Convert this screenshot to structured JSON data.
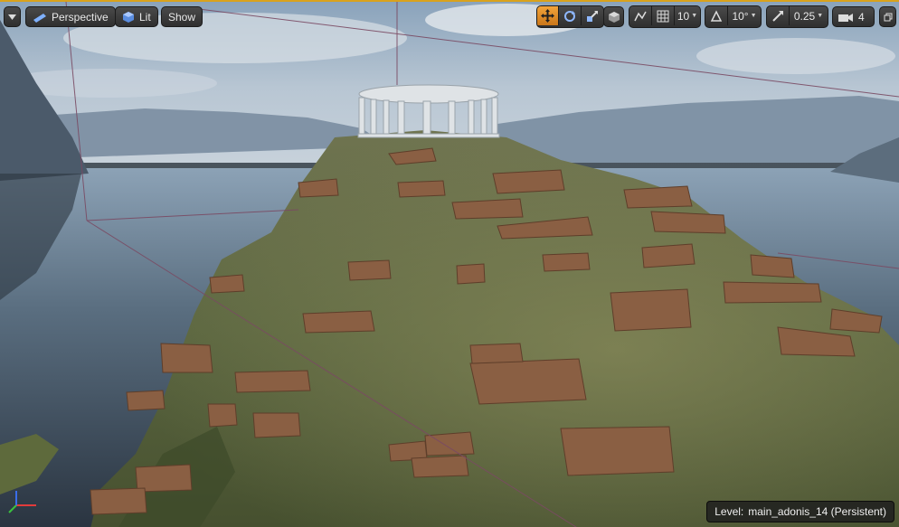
{
  "toolbar": {
    "view_mode_label": "Perspective",
    "lighting_label": "Lit",
    "show_label": "Show",
    "grid_size": "10",
    "rotation_snap": "10°",
    "scale_snap": "0.25",
    "camera_speed": "4"
  },
  "status": {
    "level_prefix": "Level:",
    "level_name": "main_adonis_14 (Persistent)"
  },
  "colors": {
    "accent_active": "#e08a22",
    "viewport_border": "#d9a21c",
    "axis_x": "#e23b3b",
    "axis_y": "#39c13f",
    "axis_z": "#3a6de8"
  }
}
